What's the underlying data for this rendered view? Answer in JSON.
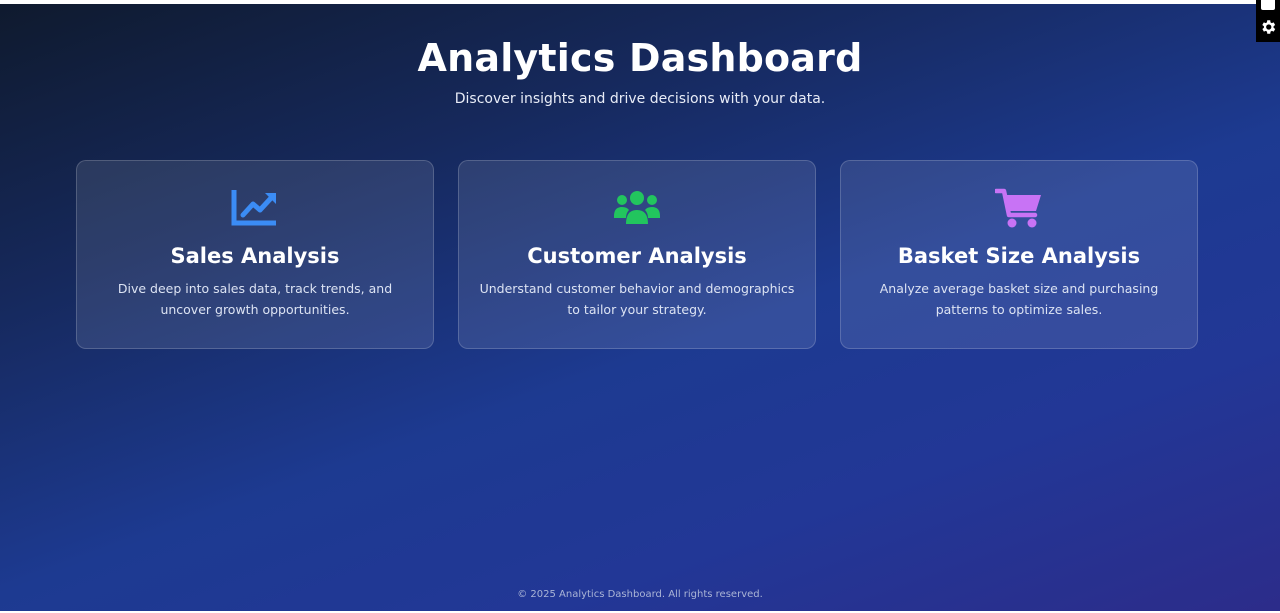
{
  "header": {
    "title": "Analytics Dashboard",
    "subtitle": "Discover insights and drive decisions with your data."
  },
  "cards": [
    {
      "title": "Sales Analysis",
      "description": "Dive deep into sales data, track trends, and uncover growth opportunities.",
      "icon": "chart-line-icon",
      "icon_color": "#3b8cf5"
    },
    {
      "title": "Customer Analysis",
      "description": "Understand customer behavior and demographics to tailor your strategy.",
      "icon": "users-icon",
      "icon_color": "#22c55e"
    },
    {
      "title": "Basket Size Analysis",
      "description": "Analyze average basket size and purchasing patterns to optimize sales.",
      "icon": "shopping-cart-icon",
      "icon_color": "#c873f5"
    }
  ],
  "footer": {
    "text": "© 2025 Analytics Dashboard. All rights reserved."
  },
  "side_tools": {
    "top_icon": "panel-icon",
    "bottom_icon": "gear-icon"
  }
}
